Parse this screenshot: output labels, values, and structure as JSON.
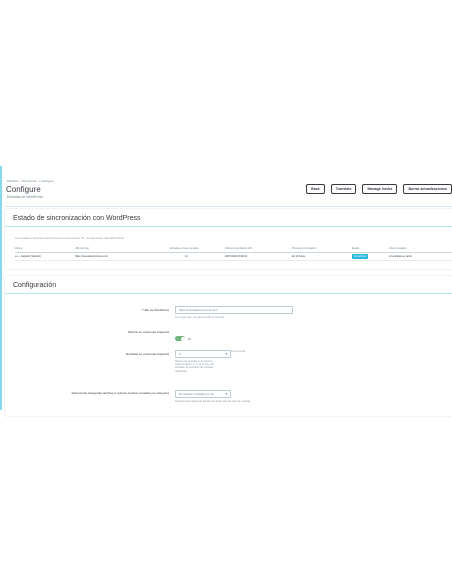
{
  "breadcrumb": [
    "Módulos",
    "Sincronizar",
    "Configure"
  ],
  "header": {
    "title": "Configure",
    "subtitle": "Entradas de WordPress"
  },
  "toolbar": {
    "back": "Back",
    "translate": "Translate",
    "manage_hooks": "Manage hooks",
    "reset_updates": "Borrar actualizaciones"
  },
  "sync": {
    "title": "Estado de sincronización con WordPress",
    "note": "Las entradas se sincronizan desde la fuente cuando expira el TTL. Intervalo actual: cada 1440 minutos.",
    "columns": [
      "Idioma",
      "URL del blog",
      "Entradas en base de datos",
      "Última comprobación API",
      "Próxima comprobación",
      "Estado",
      "Último resultado"
    ],
    "rows": [
      {
        "lang": "es — Español (Spanish)",
        "url": "https://maresdecommerce.com",
        "count": "12",
        "last": "28/07/2024 23:06:04",
        "next": "En 23 horas",
        "status": "Actualizado",
        "result": "12 entradas en caché"
      }
    ]
  },
  "config": {
    "title": "Configuración",
    "wp_url": {
      "label": "* URL de WordPress",
      "value": "https://maresdecommerce.com",
      "help": "Si lo dejas vacío, se utiliza la URL de la tienda."
    },
    "show_left": {
      "label": "Mostrar en columnas izquierda",
      "state": "Sí",
      "help": "Mostrar las entradas del blog en la columna izquierda de la tienda."
    },
    "count_left": {
      "label": "Entradas en columnas izquierda",
      "value": "3",
      "help": "Número de entradas en la columna izquierda. Entre 1 y 6. Si no hay más entradas, se mostrarán las entradas disponibles."
    },
    "categories": {
      "label": "Seleccionar categorías del blog si quieres mostrar entradas por categoría",
      "value": "No mostrar entradas por cat",
      "help": "Selecciona las categorías del blog de donde deberán salir las entradas."
    }
  }
}
